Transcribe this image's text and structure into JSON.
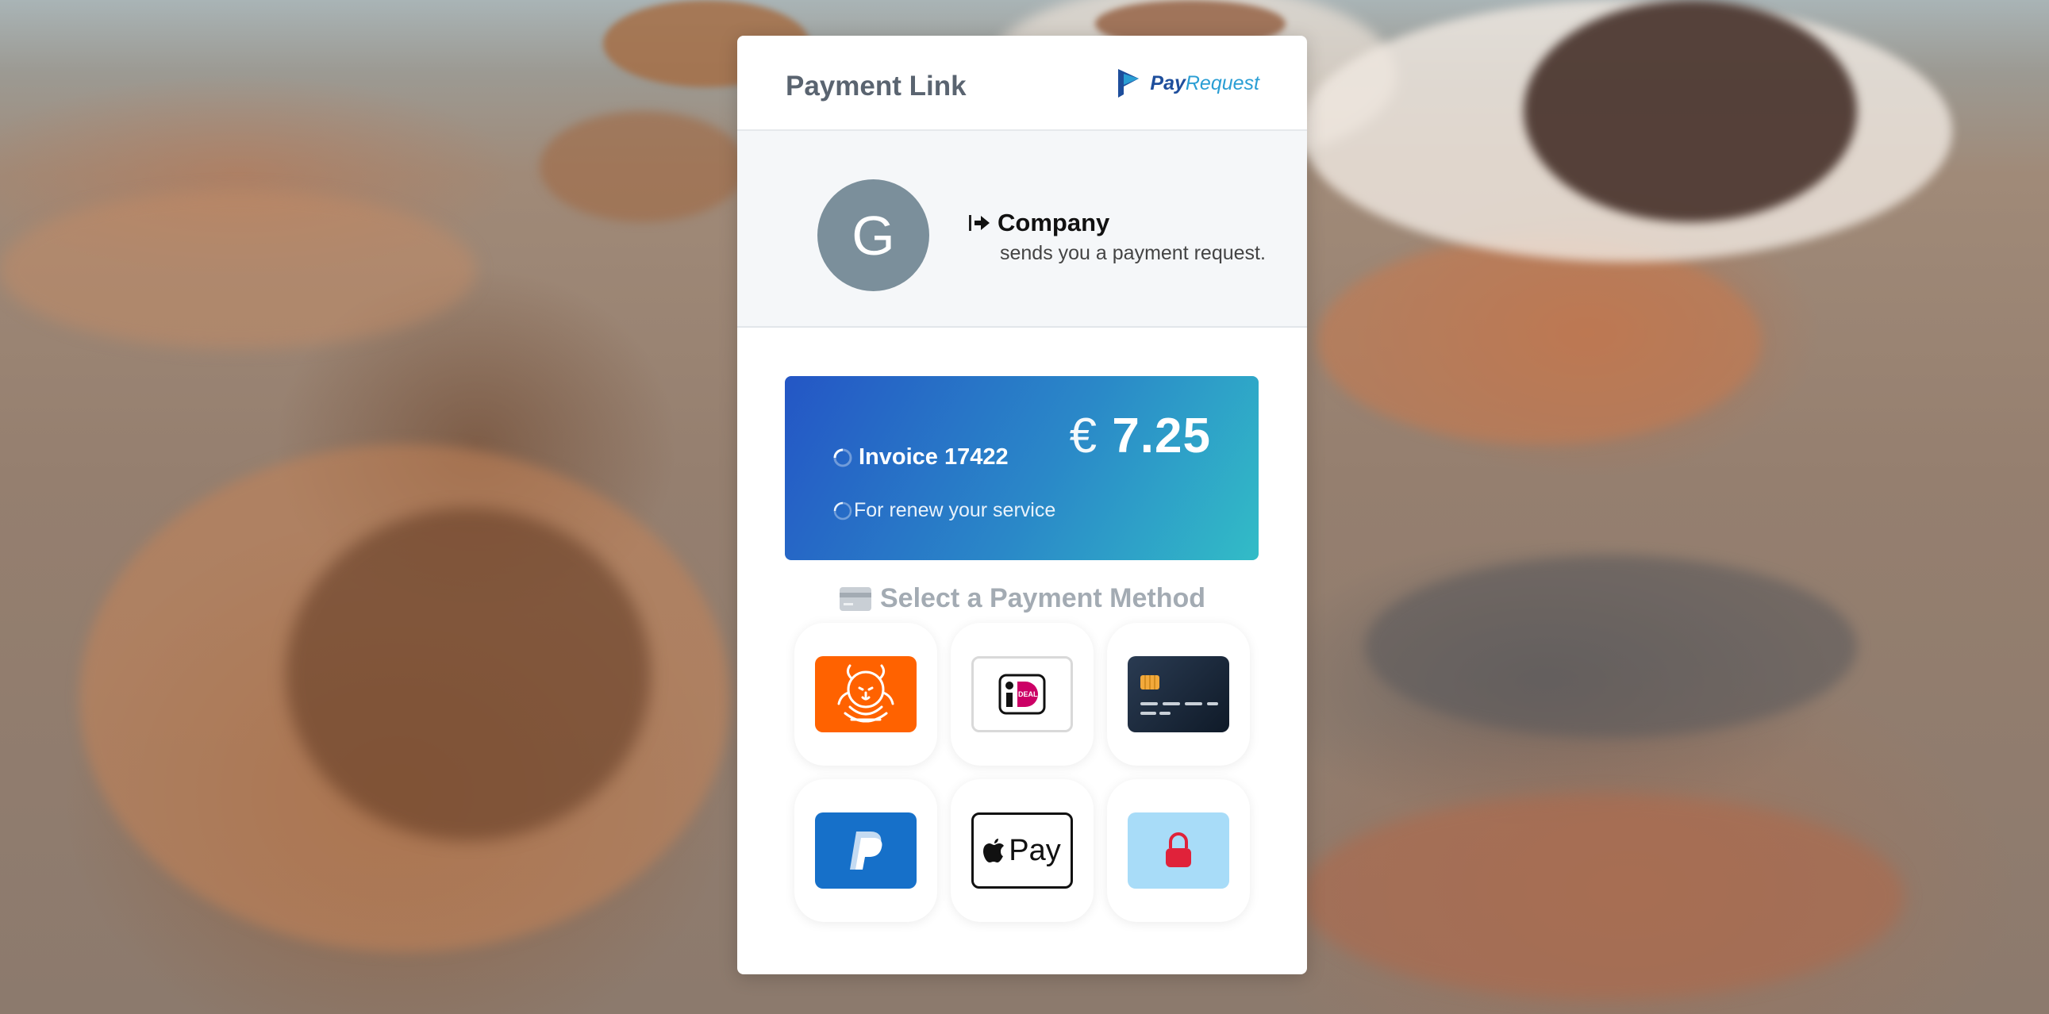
{
  "header": {
    "title": "Payment Link",
    "brand": {
      "pay": "Pay",
      "request": "Request"
    }
  },
  "merchant": {
    "avatar_letter": "G",
    "name": "Company",
    "subtitle": "sends you a payment request."
  },
  "invoice": {
    "title": "Invoice 17422",
    "currency": "€",
    "amount": "7.25",
    "description": "For renew your service"
  },
  "payment": {
    "heading": "Select a Payment Method",
    "methods": [
      {
        "id": "ing",
        "icon": "ing-lion-icon"
      },
      {
        "id": "ideal",
        "icon": "ideal-icon"
      },
      {
        "id": "card",
        "icon": "credit-card-icon"
      },
      {
        "id": "paypal",
        "icon": "paypal-icon"
      },
      {
        "id": "applepay",
        "icon": "apple-pay-icon",
        "label": "Pay"
      },
      {
        "id": "lock",
        "icon": "lock-icon"
      }
    ]
  },
  "colors": {
    "brand_dark": "#1e4e9c",
    "brand_light": "#2a9ed4",
    "invoice_gradient_start": "#2456c5",
    "invoice_gradient_end": "#32bcc7",
    "avatar": "#7b8f9b",
    "ing_orange": "#ff6200",
    "paypal_blue": "#1670c9",
    "lock_red": "#e0223a"
  }
}
